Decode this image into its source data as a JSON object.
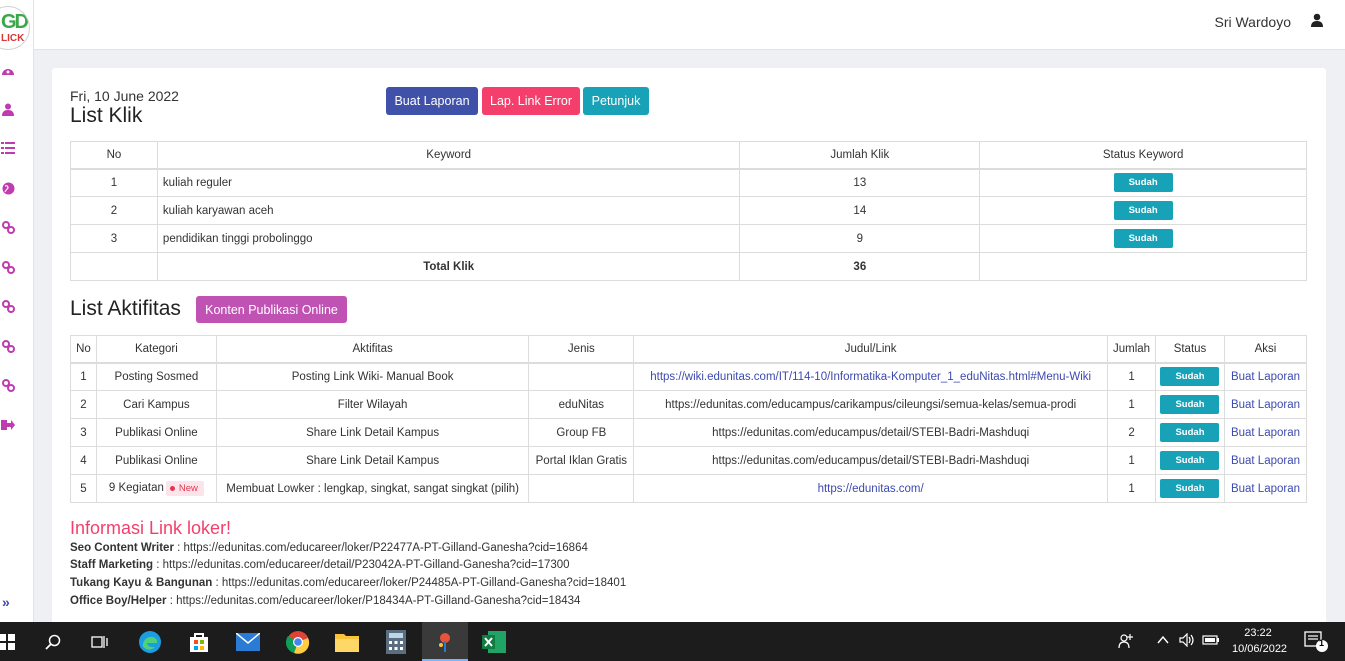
{
  "header": {
    "user_name": "Sri Wardoyo"
  },
  "sidebar": {
    "logo_top": "GD",
    "logo_bottom": "LICK",
    "icons": [
      "dashboard-icon",
      "user-icon",
      "list-icon",
      "globe-icon",
      "link-icon",
      "link-icon",
      "link-icon",
      "link-icon",
      "link-icon",
      "logout-icon"
    ]
  },
  "date": "Fri, 10 June 2022",
  "list_klik": {
    "title": "List Klik",
    "buttons": {
      "buat_laporan": "Buat Laporan",
      "link_error": "Lap. Link Error",
      "petunjuk": "Petunjuk"
    },
    "headers": [
      "No",
      "Keyword",
      "Jumlah Klik",
      "Status Keyword"
    ],
    "rows": [
      {
        "no": "1",
        "keyword": "kuliah reguler",
        "jumlah": "13",
        "status": "Sudah"
      },
      {
        "no": "2",
        "keyword": "kuliah karyawan aceh",
        "jumlah": "14",
        "status": "Sudah"
      },
      {
        "no": "3",
        "keyword": "pendidikan tinggi probolinggo",
        "jumlah": "9",
        "status": "Sudah"
      }
    ],
    "total_label": "Total Klik",
    "total_value": "36"
  },
  "list_aktifitas": {
    "title": "List Aktifitas",
    "button": "Konten Publikasi Online",
    "headers": [
      "No",
      "Kategori",
      "Aktifitas",
      "Jenis",
      "Judul/Link",
      "Jumlah",
      "Status",
      "Aksi"
    ],
    "rows": [
      {
        "no": "1",
        "kategori": "Posting Sosmed",
        "aktifitas": "Posting Link Wiki- Manual Book",
        "jenis": "",
        "link": "https://wiki.edunitas.com/IT/114-10/Informatika-Komputer_1_eduNitas.html#Menu-Wiki",
        "jumlah": "1",
        "status": "Sudah",
        "aksi": "Buat Laporan"
      },
      {
        "no": "2",
        "kategori": "Cari Kampus",
        "aktifitas": "Filter Wilayah",
        "jenis": "eduNitas",
        "link": "https://edunitas.com/educampus/carikampus/cileungsi/semua-kelas/semua-prodi",
        "jumlah": "1",
        "status": "Sudah",
        "aksi": "Buat Laporan"
      },
      {
        "no": "3",
        "kategori": "Publikasi Online",
        "aktifitas": "Share Link Detail Kampus",
        "jenis": "Group FB",
        "link": "https://edunitas.com/educampus/detail/STEBI-Badri-Mashduqi",
        "jumlah": "2",
        "status": "Sudah",
        "aksi": "Buat Laporan"
      },
      {
        "no": "4",
        "kategori": "Publikasi Online",
        "aktifitas": "Share Link Detail Kampus",
        "jenis": "Portal Iklan Gratis",
        "link": "https://edunitas.com/educampus/detail/STEBI-Badri-Mashduqi",
        "jumlah": "1",
        "status": "Sudah",
        "aksi": "Buat Laporan"
      },
      {
        "no": "5",
        "kategori": "9 Kegiatan",
        "new_badge": "New",
        "aktifitas": "Membuat Lowker : lengkap, singkat, sangat singkat (pilih)",
        "jenis": "",
        "link": "https://edunitas.com/",
        "jumlah": "1",
        "status": "Sudah",
        "aksi": "Buat Laporan"
      }
    ]
  },
  "info": {
    "title": "Informasi Link loker!",
    "items": [
      {
        "label": "Seo Content Writer",
        "url": " : https://edunitas.com/educareer/loker/P22477A-PT-Gilland-Ganesha?cid=16864"
      },
      {
        "label": "Staff Marketing",
        "url": " : https://edunitas.com/educareer/detail/P23042A-PT-Gilland-Ganesha?cid=17300"
      },
      {
        "label": "Tukang Kayu & Bangunan",
        "url": " : https://edunitas.com/educareer/loker/P24485A-PT-Gilland-Ganesha?cid=18401"
      },
      {
        "label": "Office Boy/Helper",
        "url": " : https://edunitas.com/educareer/loker/P18434A-PT-Gilland-Ganesha?cid=18434"
      }
    ]
  },
  "taskbar": {
    "time": "23:22",
    "date": "10/06/2022",
    "notification_count": "1",
    "apps": [
      "windows-start-icon",
      "search-icon",
      "task-view-icon",
      "edge-icon",
      "store-icon",
      "mail-icon",
      "chrome-icon",
      "file-explorer-icon",
      "calculator-icon",
      "paint-app-icon",
      "excel-icon"
    ]
  }
}
